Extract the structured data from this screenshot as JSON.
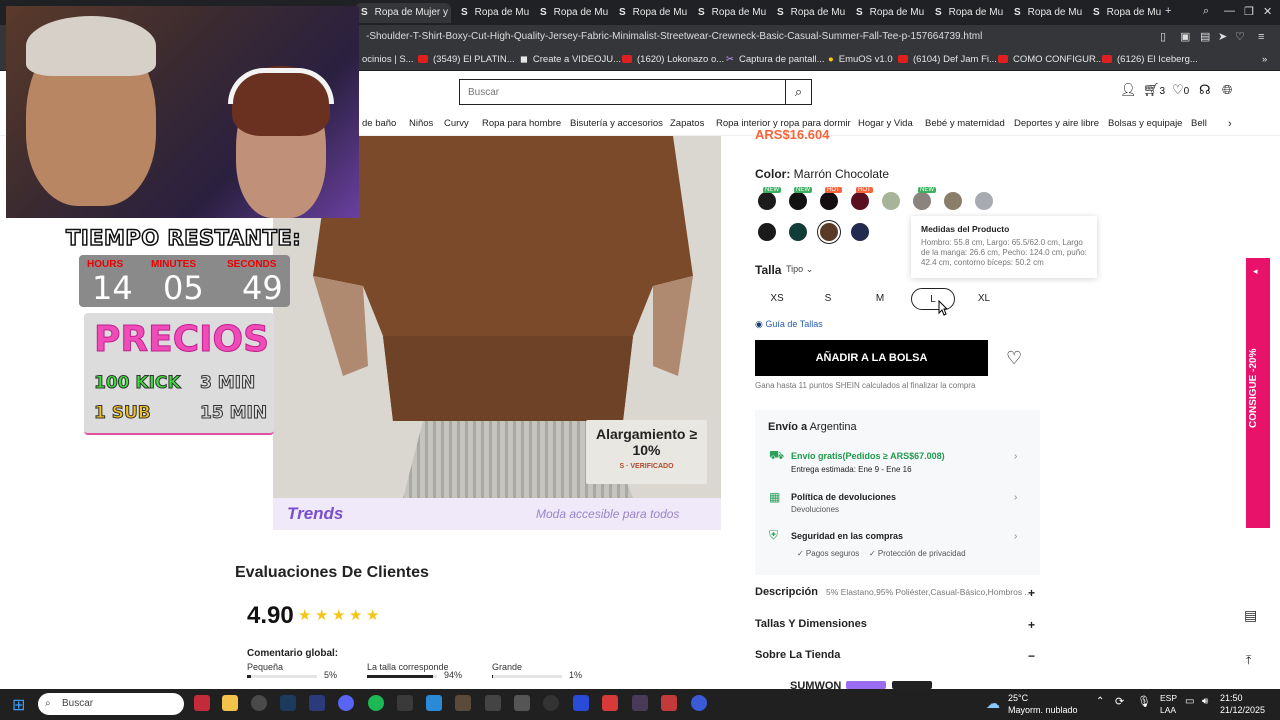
{
  "browser": {
    "tabs": [
      {
        "label": "Ropa de Mujer y Hombr",
        "icon": "S"
      },
      {
        "label": "Ropa de Mu",
        "icon": "S"
      },
      {
        "label": "Ropa de Mu",
        "icon": "S"
      },
      {
        "label": "Ropa de Mu",
        "icon": "S"
      },
      {
        "label": "Ropa de Mu",
        "icon": "S"
      },
      {
        "label": "Ropa de Mu",
        "icon": "S"
      },
      {
        "label": "Ropa de Mu",
        "icon": "S"
      },
      {
        "label": "Ropa de Mu",
        "icon": "S"
      },
      {
        "label": "Ropa de Mu",
        "icon": "S"
      },
      {
        "label": "Ropa de Mu",
        "icon": "S"
      }
    ],
    "url": "-Shoulder-T-Shirt-Boxy-Cut-High-Quality-Jersey-Fabric-Minimalist-Streetwear-Crewneck-Basic-Casual-Summer-Fall-Tee-p-157664739.html",
    "bookmarks": [
      "ocinios | S...",
      "(3549) El PLATIN...",
      "Create a VIDEOJU...",
      "(1620) Lokonazo o...",
      "Captura de pantall...",
      "EmuOS v1.0",
      "(6104) Def Jam Fi...",
      "COMO CONFIGUR...",
      "(6126) El Iceberg..."
    ]
  },
  "header": {
    "search_placeholder": "Buscar",
    "cart_count": "3",
    "wishlist_count": "0",
    "nav": [
      "de baño",
      "Niños",
      "Curvy",
      "Ropa para hombre",
      "Bisutería y accesorios",
      "Zapatos",
      "Ropa interior y ropa para dormir",
      "Hogar y Vida",
      "Bebé y maternidad",
      "Deportes y aire libre",
      "Bolsas y equipaje",
      "Bell"
    ]
  },
  "overlay": {
    "timer_title": "TIEMPO RESTANTE:",
    "hours_label": "HOURS",
    "hours": "14",
    "minutes_label": "MINUTES",
    "minutes": "05",
    "seconds_label": "SECONDS",
    "seconds": "49",
    "prices_title": "PRECIOS",
    "price_rows": [
      {
        "left": "100 KICK",
        "right": "3 MIN"
      },
      {
        "left": "1 SUB",
        "right": "15 MIN"
      }
    ]
  },
  "product_image": {
    "badge_line1": "Alargamiento ≥",
    "badge_line2": "10%",
    "badge_line3": "S · VERIFICADO",
    "brand": "Trends",
    "tagline": "Moda accesible para todos"
  },
  "reviews": {
    "title": "Evaluaciones De Clientes",
    "rating": "4.90",
    "overall_label": "Comentario global:",
    "fit": [
      {
        "label": "Pequeña",
        "pct": "5%",
        "value": 0.05
      },
      {
        "label": "La talla corresponde",
        "pct": "94%",
        "value": 0.94
      },
      {
        "label": "Grande",
        "pct": "1%",
        "value": 0.01
      }
    ]
  },
  "product": {
    "price_partial": "ARS$16.604",
    "color_label": "Color:",
    "color_value": "Marrón Chocolate",
    "swatch_tags": [
      "NEW",
      "NEW",
      "HOT",
      "HOT",
      "NEW"
    ],
    "swatches_row1": [
      "#1c1c1c",
      "#111111",
      "#140e10",
      "#5a1020",
      "#a8b49a",
      "#8a827c",
      "#8a7e6a",
      "#a8aab2"
    ],
    "swatches_row2": [
      "#1a1a1a",
      "#123c36",
      "#5a3a26",
      "#222a50"
    ],
    "tooltip_title": "Medidas del Producto",
    "tooltip_body": "Hombro: 55.8 cm, Largo: 65.5/62.0 cm, Largo de la manga: 26.6 cm, Pecho: 124.0 cm, puño: 42.4 cm, contorno bíceps: 50.2 cm",
    "size_label": "Talla",
    "size_type": "Tipo",
    "sizes": [
      "XS",
      "S",
      "M",
      "L",
      "XL"
    ],
    "size_guide": "Guía de Tallas",
    "add_to_bag": "AÑADIR A LA BOLSA",
    "points_note": "Gana hasta 11 puntos SHEIN calculados al finalizar la compra",
    "ship_to_label": "Envío a",
    "ship_to_country": "Argentina",
    "free_shipping": "Envío gratis(Pedidos ≥ ARS$67.008)",
    "delivery": "Entrega estimada: Ene 9 - Ene 16",
    "returns_title": "Política de devoluciones",
    "returns_sub": "Devoluciones",
    "security_title": "Seguridad en las compras",
    "secure_pay": "✓ Pagos seguros",
    "privacy": "✓ Protección de privacidad",
    "desc_title": "Descripción",
    "desc_text": "5% Elastano,95% Poliéster,Casual-Básico,Hombros ...",
    "sizes_title": "Tallas Y Dimensiones",
    "store_title": "Sobre La Tienda",
    "store_name": "SUMWON",
    "promo": "CONSIGUE -20%"
  },
  "taskbar": {
    "search": "Buscar",
    "weather_temp": "25°C",
    "weather_desc": "Mayorm. nublado",
    "lang1": "ESP",
    "lang2": "LAA",
    "time": "21:50",
    "date": "21/12/2025"
  }
}
